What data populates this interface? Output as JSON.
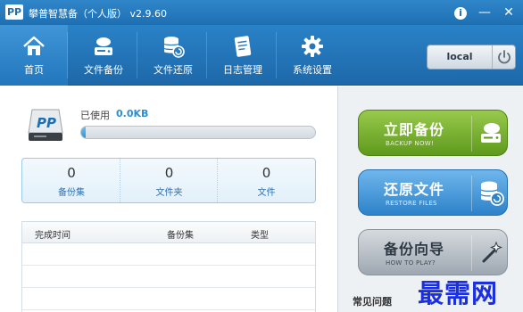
{
  "window": {
    "logo_text": "PP",
    "title": "攀普智慧备（个人版） v2.9.60"
  },
  "title_buttons": {
    "info": "i",
    "minimize": "—",
    "close": "✕"
  },
  "toolbar": {
    "items": [
      {
        "label": "首页",
        "icon": "home-icon",
        "active": true
      },
      {
        "label": "文件备份",
        "icon": "file-backup-icon",
        "active": false
      },
      {
        "label": "文件还原",
        "icon": "file-restore-icon",
        "active": false
      },
      {
        "label": "日志管理",
        "icon": "log-icon",
        "active": false
      },
      {
        "label": "系统设置",
        "icon": "gear-icon",
        "active": false
      }
    ],
    "server": {
      "label": "local",
      "icon": "power-icon"
    }
  },
  "usage": {
    "label": "已使用",
    "value": "0.0KB",
    "progress": 0.02
  },
  "stats": [
    {
      "count": "0",
      "label": "备份集"
    },
    {
      "count": "0",
      "label": "文件夹"
    },
    {
      "count": "0",
      "label": "文件"
    }
  ],
  "table": {
    "columns": [
      "完成时间",
      "备份集",
      "类型"
    ],
    "rows": []
  },
  "actions": {
    "backup": {
      "label": "立即备份",
      "sub": "BACKUP NOW!",
      "icon": "backup-drive-icon"
    },
    "restore": {
      "label": "还原文件",
      "sub": "RESTORE FILES",
      "icon": "restore-db-icon"
    },
    "wizard": {
      "label": "备份向导",
      "sub": "HOW TO PLAY?",
      "icon": "magic-wand-icon"
    }
  },
  "faq": {
    "title": "常见问题"
  },
  "watermark": "最需网",
  "colors": {
    "primary_blue": "#1e6fb2",
    "backup_green": "#5f9a1c",
    "restore_blue": "#2d82c9",
    "wizard_gray": "#9ea8b1",
    "accent_value": "#2b8fd5"
  }
}
